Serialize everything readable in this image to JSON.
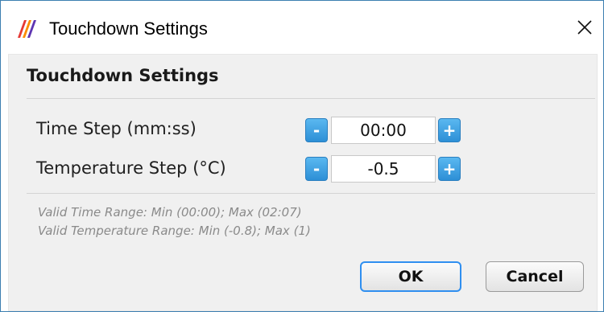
{
  "window": {
    "title": "Touchdown Settings"
  },
  "icons": {
    "app": "app-logo-icon",
    "close": "close-icon"
  },
  "section": {
    "title": "Touchdown Settings"
  },
  "fields": [
    {
      "label": "Time Step (mm:ss)",
      "value": "00:00",
      "minus": "-",
      "plus": "+"
    },
    {
      "label": "Temperature Step (°C)",
      "value": "-0.5",
      "minus": "-",
      "plus": "+"
    }
  ],
  "notes": {
    "time_range": "Valid Time Range: Min (00:00); Max (02:07)",
    "temp_range": "Valid Temperature Range: Min (-0.8); Max (1)"
  },
  "buttons": {
    "ok": "OK",
    "cancel": "Cancel"
  },
  "colors": {
    "accent": "#2d8fd6",
    "ok_border": "#2f8ff0",
    "window_border": "#3c7fb1"
  }
}
